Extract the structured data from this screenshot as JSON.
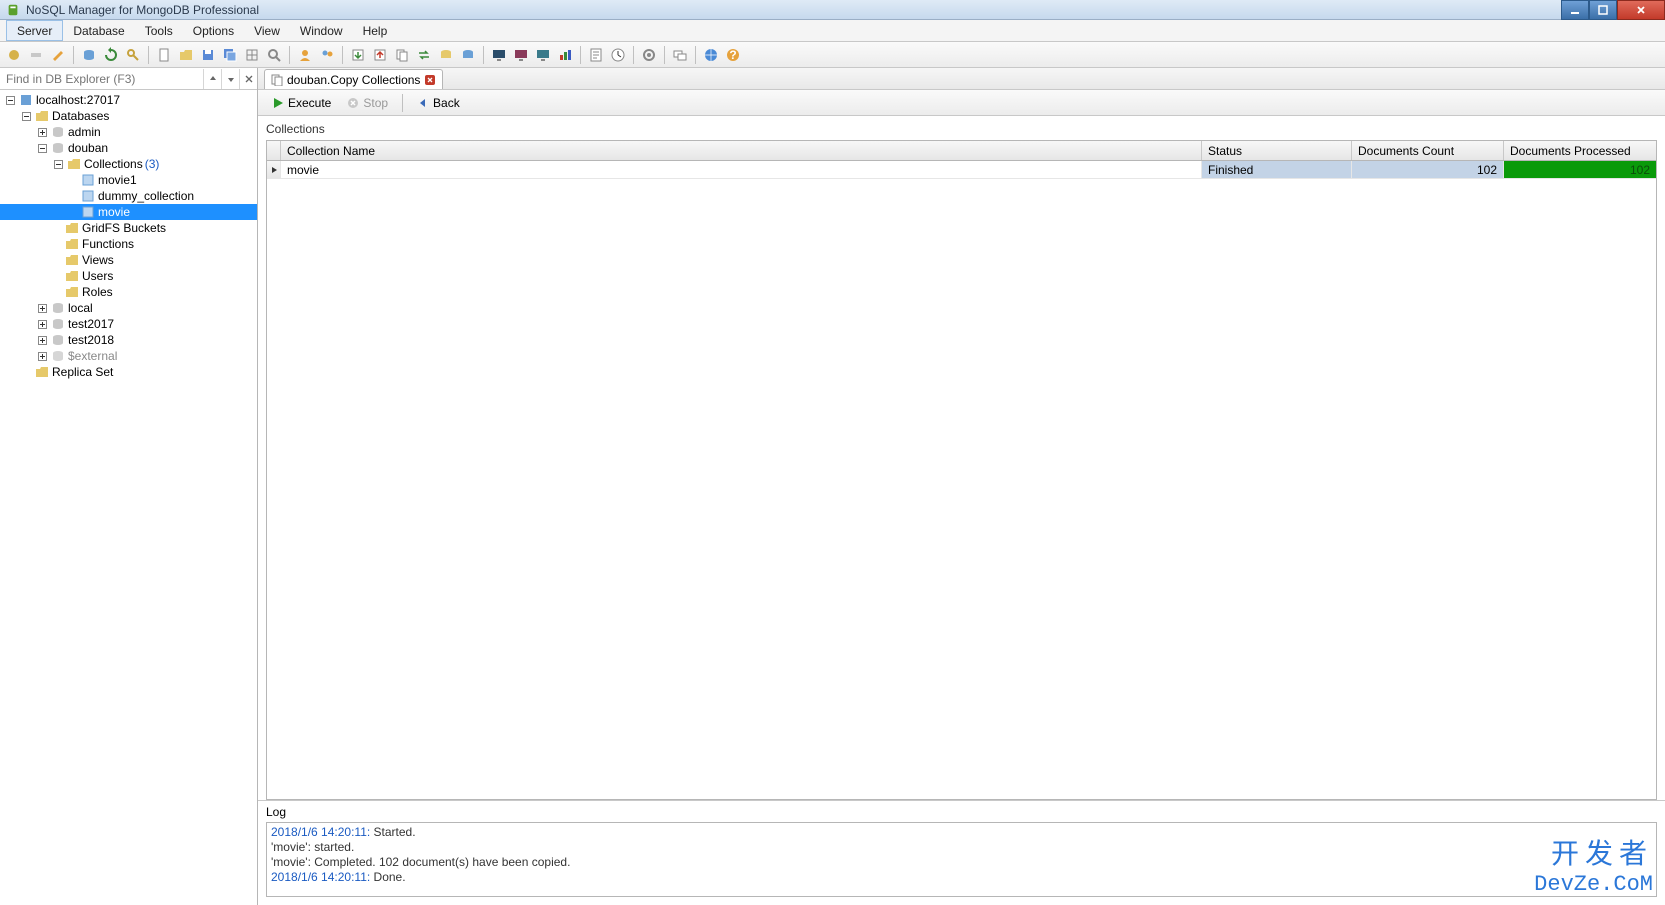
{
  "window": {
    "title": "NoSQL Manager for MongoDB Professional"
  },
  "menubar": {
    "items": [
      "Server",
      "Database",
      "Tools",
      "Options",
      "View",
      "Window",
      "Help"
    ]
  },
  "findbar": {
    "placeholder": "Find in DB Explorer (F3)"
  },
  "tree": {
    "root": {
      "label": "localhost:27017",
      "databases_label": "Databases",
      "databases": [
        {
          "label": "admin"
        },
        {
          "label": "douban",
          "collections_label": "Collections",
          "collections_count": "(3)",
          "collections": [
            {
              "label": "movie1"
            },
            {
              "label": "dummy_collection"
            },
            {
              "label": "movie",
              "selected": true
            }
          ],
          "gridfs_label": "GridFS Buckets",
          "functions_label": "Functions",
          "views_label": "Views",
          "users_label": "Users",
          "roles_label": "Roles"
        },
        {
          "label": "local"
        },
        {
          "label": "test2017"
        },
        {
          "label": "test2018"
        },
        {
          "label": "$external",
          "disabled": true
        }
      ],
      "replica_label": "Replica Set"
    }
  },
  "tabs": {
    "active": {
      "label": "douban.Copy Collections"
    }
  },
  "actionbar": {
    "execute": "Execute",
    "stop": "Stop",
    "back": "Back"
  },
  "collections_section": {
    "title": "Collections",
    "headers": {
      "name": "Collection Name",
      "status": "Status",
      "docs": "Documents Count",
      "proc": "Documents Processed"
    },
    "rows": [
      {
        "name": "movie",
        "status": "Finished",
        "docs": "102",
        "proc": "102"
      }
    ]
  },
  "log": {
    "title": "Log",
    "lines": [
      {
        "ts": "2018/1/6 14:20:11:",
        "msg": " Started."
      },
      {
        "ts": "",
        "msg": "'movie': started."
      },
      {
        "ts": "",
        "msg": "'movie': Completed. 102 document(s) have been copied."
      },
      {
        "ts": "2018/1/6 14:20:11:",
        "msg": " Done."
      }
    ]
  },
  "watermark": {
    "cn": "开发者",
    "url": "DevZe.CoM"
  }
}
